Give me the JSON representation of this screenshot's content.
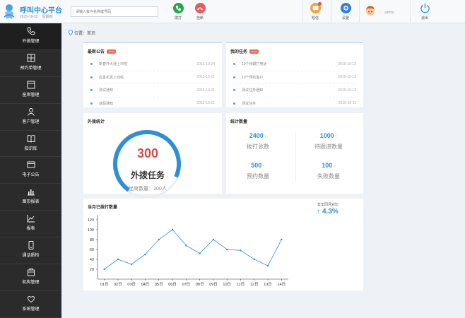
{
  "header": {
    "title": "呼叫中心平台",
    "date": "2015-10-22",
    "weekday": "星期四",
    "search_placeholder": "请输入客户名称或号码",
    "dial_label": "拨打",
    "hangup_label": "挂断",
    "sms_label": "短信",
    "settings_label": "设置",
    "username": "admin",
    "logout_label": "退出"
  },
  "sidebar": {
    "items": [
      {
        "label": "外拨管理",
        "icon": "phone-icon"
      },
      {
        "label": "预约单管理",
        "icon": "order-grid-icon"
      },
      {
        "label": "座席管理",
        "icon": "seat-box-icon"
      },
      {
        "label": "客户管理",
        "icon": "user-icon"
      },
      {
        "label": "知识库",
        "icon": "book-icon"
      },
      {
        "label": "电子公告",
        "icon": "bulletin-icon"
      },
      {
        "label": "图形报表",
        "icon": "bar-chart-icon"
      },
      {
        "label": "报表",
        "icon": "line-chart-icon"
      },
      {
        "label": "通话质检",
        "icon": "mobile-icon"
      },
      {
        "label": "机构管理",
        "icon": "org-icon"
      },
      {
        "label": "系统管理",
        "icon": "settings-heart-icon"
      }
    ]
  },
  "breadcrumb": "位置：首页",
  "announcements": {
    "title": "最新公告",
    "badge": "new",
    "rows": [
      {
        "text": "新春开大通上市啦",
        "date": "2015-10-24"
      },
      {
        "text": "完善机发上线啦",
        "date": "2015-10-21"
      },
      {
        "text": "测试通知",
        "date": "2015-10-21"
      },
      {
        "text": "放假通知",
        "date": "2015-10-21"
      }
    ]
  },
  "tasks": {
    "title": "我的任务",
    "badge": "new",
    "rows": [
      {
        "text": "10个待跟打电话",
        "date": "2015-10-13"
      },
      {
        "text": "10个预约客户",
        "date": "2015-10-13"
      },
      {
        "text": "测试任务通知",
        "date": "2015-10-12"
      },
      {
        "text": "测试任务",
        "date": "2015-10-11"
      }
    ]
  },
  "outbound": {
    "title": "外拨统计",
    "count": "300",
    "label": "外拨任务",
    "seats": "坐席数量：200人",
    "progress": 0.72
  },
  "stats": {
    "title": "统计数量",
    "items": [
      {
        "value": "2400",
        "label": "拨打总数"
      },
      {
        "value": "1000",
        "label": "待跟进数量"
      },
      {
        "value": "500",
        "label": "预约数量"
      },
      {
        "value": "100",
        "label": "失败数量"
      }
    ],
    "arrow": "↑"
  },
  "monthly": {
    "title": "当月已拨打数量",
    "compare_label": "去年同月对比",
    "compare_value": "4.3%",
    "compare_arrow": "↑"
  },
  "colors": {
    "accent": "#2f8fd6",
    "sidebar": "#2b2b2b",
    "alert": "#d94a4a",
    "dial": "#26a64a",
    "hangup": "#e85b5b",
    "sms": "#f2a33a",
    "settings": "#2f7fd6"
  },
  "chart_data": {
    "type": "line",
    "categories": [
      "01日",
      "02日",
      "03日",
      "04日",
      "05日",
      "06日",
      "07日",
      "08日",
      "09日",
      "10日",
      "11日",
      "12日",
      "13日",
      "14日"
    ],
    "values": [
      20,
      40,
      30,
      50,
      80,
      100,
      68,
      52,
      80,
      60,
      58,
      40,
      27,
      80
    ],
    "yticks": [
      20,
      40,
      60,
      80,
      100,
      120
    ],
    "ylim": [
      0,
      130
    ],
    "title": "当月已拨打数量",
    "grid": false
  }
}
